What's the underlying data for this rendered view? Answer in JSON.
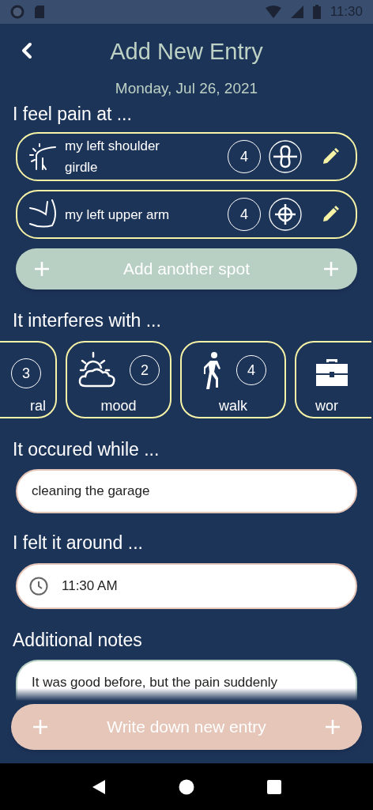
{
  "status_bar": {
    "time": "11:30"
  },
  "header": {
    "title": "Add New Entry",
    "date": "Monday, Jul 26, 2021"
  },
  "pain_section": {
    "heading": "I feel pain at ...",
    "spots": [
      {
        "kind": "girdle",
        "label": "my left shoulder girdle",
        "intensity": "4"
      },
      {
        "kind": "arm",
        "label": "my left upper arm",
        "intensity": "4"
      }
    ],
    "add_button": "Add another spot"
  },
  "interference_section": {
    "heading": "It interferes with ...",
    "chips": [
      {
        "kind": "cut",
        "label": "ral",
        "count": "3"
      },
      {
        "kind": "weather",
        "label": "mood",
        "count": "2"
      },
      {
        "kind": "walk",
        "label": "walk",
        "count": "4"
      },
      {
        "kind": "briefcase",
        "label": "wor"
      }
    ]
  },
  "activity_section": {
    "heading": "It occured while ...",
    "value": "cleaning the garage"
  },
  "time_section": {
    "heading": "I felt it around ...",
    "value": "11:30 AM"
  },
  "notes_section": {
    "heading": "Additional notes",
    "value": "It was good before, but the pain suddenly"
  },
  "submit_button": "Write down new entry"
}
